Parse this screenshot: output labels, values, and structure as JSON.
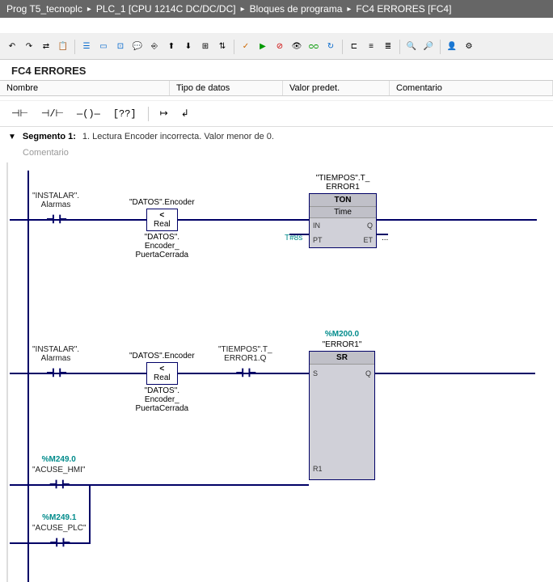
{
  "breadcrumb": [
    "Prog T5_tecnoplc",
    "PLC_1 [CPU 1214C DC/DC/DC]",
    "Bloques de programa",
    "FC4 ERRORES [FC4]"
  ],
  "block_title": "FC4 ERRORES",
  "table": {
    "col_name": "Nombre",
    "col_type": "Tipo de datos",
    "col_default": "Valor predet.",
    "col_comment": "Comentario"
  },
  "segment": {
    "label": "Segmento 1:",
    "desc": "1. Lectura Encoder incorrecta. Valor menor de 0.",
    "comment": "Comentario"
  },
  "rung1": {
    "contact1": "\"INSTALAR\".\nAlarmas",
    "cmp_top": "\"DATOS\".Encoder",
    "cmp_op": "<",
    "cmp_type": "Real",
    "cmp_bot": "\"DATOS\".\nEncoder_\nPuertaCerrada",
    "func_instance": "\"TIEMPOS\".T_\nERROR1",
    "func_title": "TON",
    "func_type": "Time",
    "pin_in": "IN",
    "pin_pt": "PT",
    "pin_q": "Q",
    "pin_et": "ET",
    "pt_val": "T#8s",
    "et_val": "..."
  },
  "rung2": {
    "contact1": "\"INSTALAR\".\nAlarmas",
    "cmp_top": "\"DATOS\".Encoder",
    "cmp_op": "<",
    "cmp_type": "Real",
    "cmp_bot": "\"DATOS\".\nEncoder_\nPuertaCerrada",
    "contact2": "\"TIEMPOS\".T_\nERROR1.Q",
    "func_addr": "%M200.0",
    "func_instance": "\"ERROR1\"",
    "func_title": "SR",
    "pin_s": "S",
    "pin_r1": "R1",
    "pin_q": "Q"
  },
  "rung3": {
    "addr1": "%M249.0",
    "name1": "\"ACUSE_HMI\"",
    "addr2": "%M249.1",
    "name2": "\"ACUSE_PLC\""
  }
}
